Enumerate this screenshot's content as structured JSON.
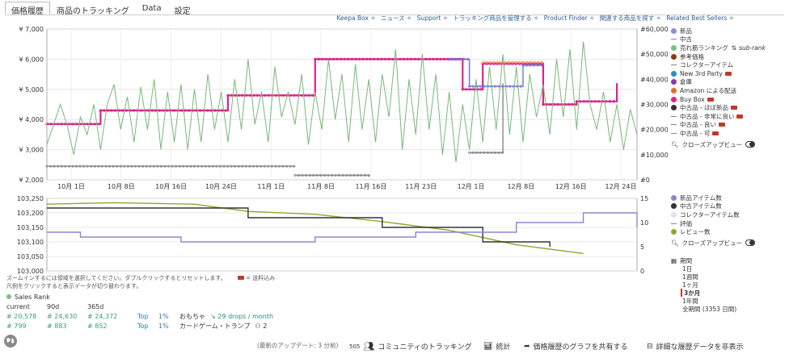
{
  "tabs": [
    {
      "label": "価格履歴",
      "active": true
    },
    {
      "label": "商品のトラッキング",
      "active": false
    },
    {
      "label": "Data",
      "active": false
    },
    {
      "label": "設定",
      "active": false
    }
  ],
  "top_links": [
    "Keepa Box ✧",
    "ニュース ✧",
    "Support ✧",
    "トラッキング商品を管理する ✧",
    "Product Finder ✧",
    "関連する商品を探す ✧",
    "Related Best Sellers ✧"
  ],
  "chart_data": [
    {
      "type": "line",
      "title": "",
      "x_ticks": [
        "10月 1日",
        "10月 8日",
        "10月 16日",
        "10月 24日",
        "11月 1日",
        "11月 8日",
        "11月 16日",
        "11月 23日",
        "12月 1日",
        "12月 8日",
        "12月 16日",
        "12月 24日"
      ],
      "y_left_ticks": [
        "¥ 7,000",
        "¥ 6,000",
        "¥ 5,000",
        "¥ 4,000",
        "¥ 3,000",
        "¥ 2,000"
      ],
      "y_right_ticks": [
        "#60,000",
        "#50,000",
        "#40,000",
        "#30,000",
        "#20,000",
        "#10,000",
        "#0"
      ],
      "ylim_left": [
        2000,
        7000
      ],
      "ylim_right": [
        0,
        60000
      ],
      "xlim_days": [
        0,
        88
      ],
      "series": [
        {
          "name": "Buy Box",
          "color": "#e0218a",
          "axis": "left",
          "points": [
            [
              0,
              3850
            ],
            [
              8,
              3850
            ],
            [
              8,
              4300
            ],
            [
              27,
              4300
            ],
            [
              27,
              4800
            ],
            [
              40,
              4800
            ],
            [
              40,
              6000
            ],
            [
              62,
              6000
            ],
            [
              62,
              5000
            ],
            [
              65,
              5000
            ],
            [
              65,
              5850
            ],
            [
              74,
              5850
            ],
            [
              74,
              4500
            ],
            [
              79,
              4500
            ],
            [
              79,
              4600
            ],
            [
              85,
              4600
            ],
            [
              85,
              5200
            ],
            [
              99,
              5200
            ]
          ]
        },
        {
          "name": "新品",
          "color": "#6a74d6",
          "axis": "left",
          "points": [
            [
              60,
              6000
            ],
            [
              63,
              6000
            ],
            [
              63,
              5100
            ],
            [
              71,
              5100
            ],
            [
              71,
              5800
            ],
            [
              74,
              5800
            ]
          ]
        },
        {
          "name": "コレクターアイテム",
          "color": "#f0a878",
          "axis": "left",
          "points": [
            [
              65,
              5900
            ],
            [
              74,
              5900
            ]
          ]
        },
        {
          "name": "売れ筋ランキング",
          "color": "#78b878",
          "axis": "right",
          "points": [
            [
              0,
              14000
            ],
            [
              2,
              30000
            ],
            [
              3,
              22000
            ],
            [
              4,
              10000
            ],
            [
              5,
              25000
            ],
            [
              6,
              18000
            ],
            [
              7,
              30000
            ],
            [
              8,
              12000
            ],
            [
              9,
              30000
            ],
            [
              10,
              38000
            ],
            [
              11,
              20000
            ],
            [
              12,
              33000
            ],
            [
              13,
              15000
            ],
            [
              14,
              37000
            ],
            [
              15,
              20000
            ],
            [
              16,
              40000
            ],
            [
              17,
              12000
            ],
            [
              18,
              35000
            ],
            [
              19,
              15000
            ],
            [
              20,
              38000
            ],
            [
              21,
              12000
            ],
            [
              22,
              36000
            ],
            [
              23,
              15000
            ],
            [
              24,
              42000
            ],
            [
              25,
              20000
            ],
            [
              26,
              35000
            ],
            [
              27,
              15000
            ],
            [
              28,
              40000
            ],
            [
              29,
              20000
            ],
            [
              30,
              48000
            ],
            [
              31,
              22000
            ],
            [
              32,
              35000
            ],
            [
              33,
              15000
            ],
            [
              34,
              45000
            ],
            [
              35,
              25000
            ],
            [
              36,
              35000
            ],
            [
              37,
              22000
            ],
            [
              38,
              42000
            ],
            [
              39,
              14000
            ],
            [
              40,
              35000
            ],
            [
              41,
              20000
            ],
            [
              42,
              48000
            ],
            [
              43,
              24000
            ],
            [
              44,
              42000
            ],
            [
              45,
              15000
            ],
            [
              46,
              46000
            ],
            [
              47,
              20000
            ],
            [
              48,
              40000
            ],
            [
              49,
              15000
            ],
            [
              50,
              42000
            ],
            [
              51,
              25000
            ],
            [
              52,
              52000
            ],
            [
              53,
              12000
            ],
            [
              54,
              40000
            ],
            [
              55,
              18000
            ],
            [
              56,
              50000
            ],
            [
              57,
              20000
            ],
            [
              58,
              42000
            ],
            [
              59,
              10000
            ],
            [
              60,
              35000
            ],
            [
              61,
              7000
            ],
            [
              62,
              30000
            ],
            [
              63,
              12000
            ],
            [
              64,
              40000
            ],
            [
              65,
              15000
            ],
            [
              66,
              45000
            ],
            [
              67,
              20000
            ],
            [
              68,
              50000
            ],
            [
              69,
              18000
            ],
            [
              70,
              45000
            ],
            [
              71,
              15000
            ],
            [
              72,
              42000
            ],
            [
              73,
              25000
            ],
            [
              74,
              38000
            ],
            [
              75,
              18000
            ],
            [
              76,
              48000
            ],
            [
              77,
              25000
            ],
            [
              78,
              52000
            ],
            [
              79,
              20000
            ],
            [
              80,
              55000
            ],
            [
              81,
              30000
            ],
            [
              82,
              20000
            ],
            [
              83,
              35000
            ],
            [
              84,
              15000
            ],
            [
              85,
              30000
            ],
            [
              86,
              12000
            ],
            [
              87,
              28000
            ],
            [
              88,
              18000
            ]
          ]
        },
        {
          "name": "中古品 - ほぼ新品",
          "color": "#888888",
          "axis": "left",
          "points": [
            [
              0,
              2450
            ],
            [
              37,
              2450
            ]
          ]
        },
        {
          "name": "中古品 - 非常に良い",
          "color": "#888888",
          "axis": "left",
          "points": [
            [
              37,
              2150
            ],
            [
              48,
              2150
            ],
            [
              48,
              2100
            ],
            [
              99,
              2100
            ]
          ]
        },
        {
          "name": "中古品 - 良い",
          "color": "#888888",
          "axis": "left",
          "points": [
            [
              63,
              2900
            ],
            [
              68,
              2900
            ],
            [
              68,
              5200
            ],
            [
              99,
              5200
            ]
          ]
        }
      ]
    },
    {
      "type": "line",
      "title": "",
      "y_left_ticks": [
        "103,250",
        "103,200",
        "103,150",
        "103,100",
        "103,050",
        "103,000"
      ],
      "y_right_ticks": [
        "15",
        "10",
        "5",
        "0"
      ],
      "ylim_left": [
        103000,
        103250
      ],
      "ylim_right": [
        0,
        15
      ],
      "xlim_days": [
        0,
        88
      ],
      "series": [
        {
          "name": "レビュー数",
          "color": "#8aaa2a",
          "axis": "left",
          "points": [
            [
              0,
              103230
            ],
            [
              10,
              103235
            ],
            [
              22,
              103230
            ],
            [
              30,
              103205
            ],
            [
              40,
              103195
            ],
            [
              50,
              103170
            ],
            [
              60,
              103140
            ],
            [
              70,
              103090
            ],
            [
              80,
              103060
            ],
            [
              90,
              103050
            ],
            [
              99,
              103045
            ]
          ]
        },
        {
          "name": "中古アイテム数",
          "color": "#333333",
          "axis": "right",
          "points": [
            [
              0,
              13
            ],
            [
              30,
              13
            ],
            [
              30,
              11
            ],
            [
              50,
              11
            ],
            [
              50,
              9
            ],
            [
              65,
              9
            ],
            [
              65,
              6
            ],
            [
              75,
              6
            ],
            [
              75,
              5
            ],
            [
              90,
              5
            ],
            [
              90,
              4
            ],
            [
              99,
              4
            ]
          ]
        },
        {
          "name": "新品アイテム数",
          "color": "#8888d0",
          "axis": "right",
          "points": [
            [
              0,
              8
            ],
            [
              5,
              8
            ],
            [
              5,
              7
            ],
            [
              20,
              7
            ],
            [
              20,
              6
            ],
            [
              40,
              6
            ],
            [
              40,
              7
            ],
            [
              55,
              7
            ],
            [
              55,
              8
            ],
            [
              70,
              8
            ],
            [
              70,
              10
            ],
            [
              80,
              10
            ],
            [
              80,
              12
            ],
            [
              88,
              12
            ],
            [
              88,
              9
            ],
            [
              94,
              9
            ],
            [
              94,
              7
            ],
            [
              99,
              7
            ]
          ]
        }
      ]
    }
  ],
  "legend_top": [
    {
      "label": "新品",
      "kind": "dot",
      "color": "#8b8fd6"
    },
    {
      "label": "中古",
      "kind": "dash",
      "color": "#888888"
    },
    {
      "label": "売れ筋ランキング",
      "kind": "dot",
      "color": "#7fbf7f",
      "extra": "sub-rank"
    },
    {
      "label": "参考価格",
      "kind": "dot",
      "color": "#8b3a1a"
    },
    {
      "label": "コレクターアイテム",
      "kind": "dash",
      "color": "#888888"
    },
    {
      "label": "New 3rd Party",
      "kind": "dot",
      "color": "#2a8fc8",
      "truck": true
    },
    {
      "label": "倉庫",
      "kind": "dot",
      "color": "#8a3ab0"
    },
    {
      "label": "Amazon による配送",
      "kind": "dot",
      "color": "#ea6a2a"
    },
    {
      "label": "Buy Box",
      "kind": "dot",
      "color": "#e0218a",
      "truck": true
    },
    {
      "label": "中古品 - ほぼ新品",
      "kind": "dot",
      "color": "#333333",
      "truck": true
    },
    {
      "label": "中古品 - 非常に良い",
      "kind": "dash",
      "color": "#888888",
      "truck": true
    },
    {
      "label": "中古品 - 良い",
      "kind": "dash",
      "color": "#888888",
      "truck": true
    },
    {
      "label": "中古品 - 可",
      "kind": "dash",
      "color": "#888888",
      "truck": true
    }
  ],
  "closeup_label": "クローズアップビュー",
  "legend_bottom": [
    {
      "label": "新品アイテム数",
      "color": "#8888d0"
    },
    {
      "label": "中古アイテム数",
      "color": "#333333"
    },
    {
      "label": "コレクターアイテム数",
      "color": "#dde0f0"
    },
    {
      "label": "評価",
      "kind": "dash",
      "color": "#888888"
    },
    {
      "label": "レビュー数",
      "color": "#8aaa2a"
    }
  ],
  "period": {
    "label": "期間",
    "options": [
      "1日",
      "1週間",
      "1ヶ月",
      "3か月",
      "1年間",
      "全期間 (3353 日間)"
    ],
    "selected": "3か月"
  },
  "hint": {
    "line1": "ズームインするには領域を選択してください。ダブルクリックするとリセットします。",
    "truck_note": "= 送料込み",
    "line2": "凡例をクリックすると表示データが切り替わります。"
  },
  "stats": {
    "title": "Sales Rank",
    "headers": [
      "current",
      "90d",
      "365d"
    ],
    "rows": [
      {
        "current": "20,578",
        "d90": "24,630",
        "d365": "24,372",
        "top": "Top",
        "pct": "1%",
        "category": "おもちゃ",
        "drops": "29 drops / month"
      },
      {
        "current": "799",
        "d90": "883",
        "d365": "852",
        "top": "Top",
        "pct": "1%",
        "category": "カードゲーム・トランプ",
        "drops": "2"
      }
    ]
  },
  "footer": {
    "last_update": "(最新のアップデート: 3 分前)",
    "count": "505",
    "community": "コミュニティのトラッキング",
    "stats": "統計",
    "share": "価格履歴のグラフを共有する",
    "hide": "詳細な履歴データを非表示"
  }
}
